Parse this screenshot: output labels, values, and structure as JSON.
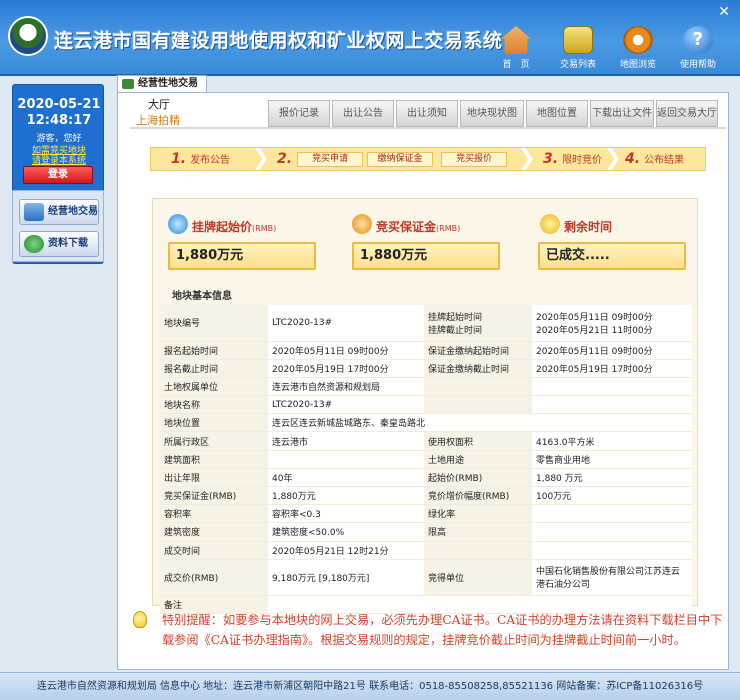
{
  "header": {
    "title": "连云港市国有建设用地使用权和矿业权网上交易系统",
    "close": "✕",
    "nav": [
      {
        "label": "首　页",
        "icon": "home-icon"
      },
      {
        "label": "交易列表",
        "icon": "list-icon"
      },
      {
        "label": "地图浏览",
        "icon": "map-icon"
      },
      {
        "label": "使用帮助",
        "icon": "help-icon"
      }
    ]
  },
  "left": {
    "date": "2020-05-21",
    "time": "12:48:17",
    "greeting": "游客，您好",
    "link1": "如需竞买地块",
    "link2": "请登录本系统",
    "login_label": "登录",
    "menu": [
      {
        "label": "经营地交易",
        "icon": "land-icon"
      },
      {
        "label": "资料下载",
        "icon": "download-icon"
      }
    ]
  },
  "tab": {
    "label": "经营性地交易"
  },
  "main": {
    "hall_title": "大厅",
    "hall_sub": "上海拍精",
    "subnav": [
      "报价记录",
      "出让公告",
      "出让须知",
      "地块现状图",
      "地图位置",
      "下载出让文件",
      "返回交易大厅"
    ],
    "steps": [
      {
        "num": "1.",
        "label": "发布公告"
      },
      {
        "num": "2.",
        "label": ""
      },
      {
        "num": "3.",
        "label": "限时竞价"
      },
      {
        "num": "4.",
        "label": "公布结果"
      }
    ],
    "step_buttons": [
      "竞买申请",
      "缴纳保证金",
      "竞买报价"
    ],
    "price": {
      "start_label": "挂牌起始价",
      "start_unit": "(RMB)",
      "start_value": "1,880万元",
      "deposit_label": "竞买保证金",
      "deposit_unit": "(RMB)",
      "deposit_value": "1,880万元",
      "remain_label": "剩余时间",
      "remain_value": "已成交....."
    },
    "section_title": "地块基本信息",
    "rows": [
      {
        "l1": "地块编号",
        "v1": "LTC2020-13#",
        "l2": "挂牌起始时间",
        "v2": "2020年05月11日  09时00分",
        "tall": true,
        "l2b": "挂牌截止时间",
        "v2b": "2020年05月21日  11时00分"
      },
      {
        "l1": "报名起始时间",
        "v1": "2020年05月11日  09时00分",
        "l2": "保证金缴纳起始时间",
        "v2": "2020年05月11日  09时00分"
      },
      {
        "l1": "报名截止时间",
        "v1": "2020年05月19日  17时00分",
        "l2": "保证金缴纳截止时间",
        "v2": "2020年05月19日  17时00分"
      },
      {
        "l1": "土地权属单位",
        "v1": "连云港市自然资源和规划局",
        "l2": "",
        "v2": ""
      },
      {
        "l1": "地块名称",
        "v1": "LTC2020-13#",
        "l2": "",
        "v2": ""
      },
      {
        "l1": "地块位置",
        "v1": "连云区连云新城盐城路东、秦皇岛路北",
        "l2": "",
        "v2": ""
      },
      {
        "l1": "所属行政区",
        "v1": "连云港市",
        "l2": "使用权面积",
        "v2": "4163.0平方米"
      },
      {
        "l1": "建筑面积",
        "v1": "",
        "l2": "土地用途",
        "v2": "零售商业用地"
      },
      {
        "l1": "出让年限",
        "v1": "40年",
        "l2": "起始价(RMB)",
        "v2": "1,880 万元"
      },
      {
        "l1": "竞买保证金(RMB)",
        "v1": "1,880万元",
        "l2": "竞价增价幅度(RMB)",
        "v2": "100万元"
      },
      {
        "l1": "容积率",
        "v1": "容积率<0.3",
        "l2": "绿化率",
        "v2": ""
      },
      {
        "l1": "建筑密度",
        "v1": "建筑密度<50.0%",
        "l2": "限高",
        "v2": ""
      },
      {
        "l1": "成交时间",
        "v1": "2020年05月21日  12时21分",
        "l2": "",
        "v2": ""
      },
      {
        "l1": "成交价(RMB)",
        "v1": "9,180万元 [9,180万元]",
        "l2": "竞得单位",
        "v2": "中国石化销售股份有限公司江苏连云",
        "v2c": "港石油分公司",
        "tall": true
      },
      {
        "l1": "备注",
        "v1": "",
        "l2": "",
        "v2": ""
      }
    ],
    "notice_prefix": "特别提醒：",
    "notice": "如要参与本地块的网上交易，必须先办理CA证书。CA证书的办理方法请在资料下载栏目中下载参阅《CA证书办理指南》。根据交易规则的规定，挂牌竞价截止时间为挂牌截止时间前一小时。"
  },
  "footer": "连云港市自然资源和规划局 信息中心  地址：连云港市新浦区朝阳中路21号 联系电话：0518-85508258,85521136  网站备案：苏ICP备11026316号",
  "colors": {
    "header": "#3b8ad8",
    "accent": "#c0392b",
    "steps": "#fde79a",
    "notice": "#d9412a"
  }
}
